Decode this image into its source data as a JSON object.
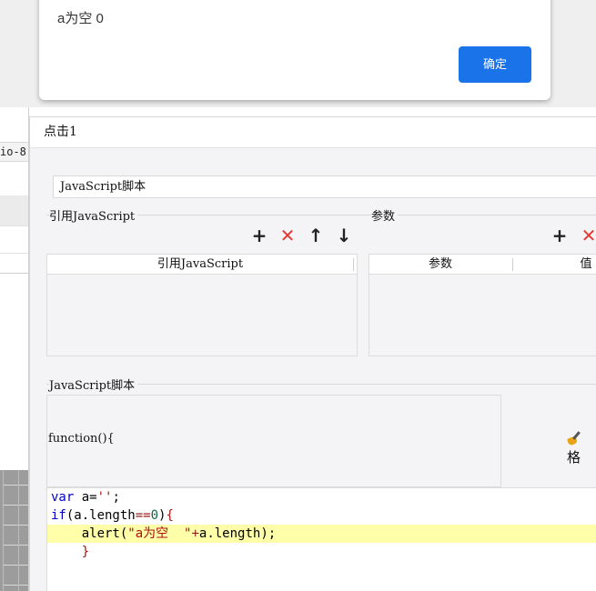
{
  "alert": {
    "message": "a为空  0",
    "ok_label": "确定"
  },
  "background": {
    "left_tab_label": "io-8"
  },
  "dialog": {
    "title": "点击1",
    "script_name": "JavaScript脚本",
    "refs_section": {
      "label": "引用JavaScript",
      "toolbar": [
        "+",
        "✕",
        "↑",
        "↓"
      ],
      "columns": [
        "引用JavaScript"
      ],
      "rows": []
    },
    "params_section": {
      "label": "参数",
      "toolbar": [
        "+",
        "✕"
      ],
      "columns": [
        "参数",
        "值"
      ],
      "rows": []
    },
    "script_section": {
      "label": "JavaScript脚本",
      "function_signature": "function(){",
      "format_label": "格"
    },
    "code_lines": [
      "var a='';",
      "if(a.length==0){",
      "    alert(\"a为空  \"+a.length);",
      "    }"
    ]
  },
  "colors": {
    "accent": "#1a73e8",
    "delete": "#e53935",
    "highlight": "#ffffaa",
    "keyword": "#0000cc",
    "string": "#aa1111"
  }
}
